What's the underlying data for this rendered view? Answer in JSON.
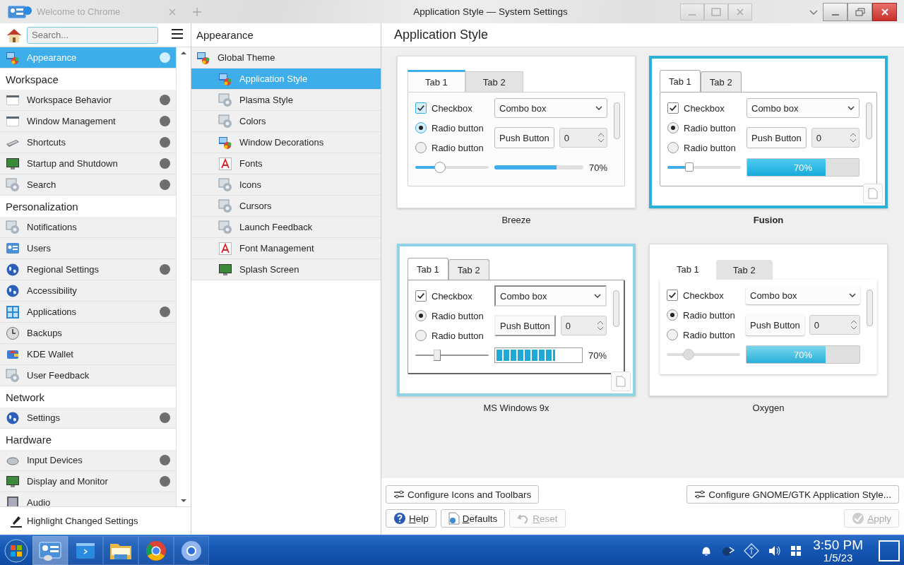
{
  "title_bar": {
    "background_tab": "Welcome to Chrome",
    "title": "Application Style — System Settings"
  },
  "sidebar": {
    "search": {
      "placeholder": "Search..."
    },
    "items": [
      {
        "kind": "item",
        "label": "Appearance",
        "selected": true,
        "changed": true
      },
      {
        "kind": "header",
        "label": "Workspace"
      },
      {
        "kind": "item",
        "label": "Workspace Behavior",
        "selected": false,
        "changed": true
      },
      {
        "kind": "item",
        "label": "Window Management",
        "selected": false,
        "changed": true
      },
      {
        "kind": "item",
        "label": "Shortcuts",
        "selected": false,
        "changed": true
      },
      {
        "kind": "item",
        "label": "Startup and Shutdown",
        "selected": false,
        "changed": true
      },
      {
        "kind": "item",
        "label": "Search",
        "selected": false,
        "changed": true
      },
      {
        "kind": "header",
        "label": "Personalization"
      },
      {
        "kind": "item",
        "label": "Notifications",
        "selected": false,
        "changed": false
      },
      {
        "kind": "item",
        "label": "Users",
        "selected": false,
        "changed": false
      },
      {
        "kind": "item",
        "label": "Regional Settings",
        "selected": false,
        "changed": true
      },
      {
        "kind": "item",
        "label": "Accessibility",
        "selected": false,
        "changed": false
      },
      {
        "kind": "item",
        "label": "Applications",
        "selected": false,
        "changed": true
      },
      {
        "kind": "item",
        "label": "Backups",
        "selected": false,
        "changed": false
      },
      {
        "kind": "item",
        "label": "KDE Wallet",
        "selected": false,
        "changed": false
      },
      {
        "kind": "item",
        "label": "User Feedback",
        "selected": false,
        "changed": false
      },
      {
        "kind": "header",
        "label": "Network"
      },
      {
        "kind": "item",
        "label": "Settings",
        "selected": false,
        "changed": true
      },
      {
        "kind": "header",
        "label": "Hardware"
      },
      {
        "kind": "item",
        "label": "Input Devices",
        "selected": false,
        "changed": true
      },
      {
        "kind": "item",
        "label": "Display and Monitor",
        "selected": false,
        "changed": true
      },
      {
        "kind": "item",
        "label": "Audio",
        "selected": false,
        "changed": false
      }
    ],
    "footer": "Highlight Changed Settings"
  },
  "category": {
    "title": "Appearance",
    "items": [
      {
        "label": "Global Theme",
        "selected": false,
        "children": [
          {
            "label": "Application Style",
            "selected": true
          },
          {
            "label": "Plasma Style",
            "selected": false
          },
          {
            "label": "Colors",
            "selected": false
          },
          {
            "label": "Window Decorations",
            "selected": false
          },
          {
            "label": "Fonts",
            "selected": false
          },
          {
            "label": "Icons",
            "selected": false
          },
          {
            "label": "Cursors",
            "selected": false
          },
          {
            "label": "Launch Feedback",
            "selected": false
          },
          {
            "label": "Font Management",
            "selected": false
          },
          {
            "label": "Splash Screen",
            "selected": false
          }
        ]
      }
    ]
  },
  "page": {
    "title": "Application Style",
    "styles": [
      {
        "kind": "breeze",
        "name": "Breeze",
        "selected": false,
        "hovered": false,
        "preview": {
          "tabs": [
            {
              "label": "Tab 1",
              "selected": true
            },
            {
              "label": "Tab 2",
              "selected": false
            }
          ],
          "checkbox": {
            "label": "Checkbox",
            "checked": true
          },
          "radios": [
            {
              "label": "Radio button",
              "selected": true
            },
            {
              "label": "Radio button",
              "selected": false
            }
          ],
          "combo": "Combo box",
          "push_button": "Push Button",
          "spin": "0",
          "slider": {
            "level": 0.34
          },
          "progress": {
            "level": 0.7,
            "reading": "70%"
          }
        }
      },
      {
        "kind": "fusion",
        "name": "Fusion",
        "selected": true,
        "hovered": false,
        "preview": {
          "tabs": [
            {
              "label": "Tab 1",
              "selected": true
            },
            {
              "label": "Tab 2",
              "selected": false
            }
          ],
          "checkbox": {
            "label": "Checkbox",
            "checked": true
          },
          "radios": [
            {
              "label": "Radio button",
              "selected": true
            },
            {
              "label": "Radio button",
              "selected": false
            }
          ],
          "combo": "Combo box",
          "push_button": "Push Button",
          "spin": "0",
          "slider": {
            "level": 0.3
          },
          "progress": {
            "level": 0.7,
            "reading": "70%"
          }
        }
      },
      {
        "kind": "windows",
        "name": "MS Windows 9x",
        "selected": false,
        "hovered": true,
        "preview": {
          "tabs": [
            {
              "label": "Tab 1",
              "selected": true
            },
            {
              "label": "Tab 2",
              "selected": false
            }
          ],
          "checkbox": {
            "label": "Checkbox",
            "checked": true
          },
          "radios": [
            {
              "label": "Radio button",
              "selected": true
            },
            {
              "label": "Radio button",
              "selected": false
            }
          ],
          "combo": "Combo box",
          "push_button": "Push Button",
          "spin": "0",
          "slider": {
            "level": 0.3
          },
          "progress": {
            "level": 0.7,
            "reading": "70%"
          }
        }
      },
      {
        "kind": "oxygen",
        "name": "Oxygen",
        "selected": false,
        "hovered": false,
        "preview": {
          "tabs": [
            {
              "label": "Tab 1",
              "selected": true
            },
            {
              "label": "Tab 2",
              "selected": false
            }
          ],
          "checkbox": {
            "label": "Checkbox",
            "checked": true
          },
          "radios": [
            {
              "label": "Radio button",
              "selected": true
            },
            {
              "label": "Radio button",
              "selected": false
            }
          ],
          "combo": "Combo box",
          "push_button": "Push Button",
          "spin": "0",
          "slider": {
            "level": 0.3
          },
          "progress": {
            "level": 0.7,
            "reading": "70%"
          }
        }
      }
    ],
    "config_buttons": [
      "Configure Icons and Toolbars",
      "Configure GNOME/GTK Application Style..."
    ]
  },
  "dialog_buttons": [
    {
      "kind": "help",
      "label": "Help",
      "disabled": false
    },
    {
      "kind": "defaults",
      "label": "Defaults",
      "disabled": false
    },
    {
      "kind": "reset",
      "label": "Reset",
      "disabled": true
    },
    {
      "kind": "apply",
      "label": "Apply",
      "disabled": true
    }
  ],
  "taskbar": {
    "apps": [
      {
        "active": true
      },
      {
        "active": false
      },
      {
        "active": false
      },
      {
        "active": false
      },
      {
        "active": false
      }
    ],
    "clock": {
      "time": "3:50 PM",
      "date": "1/5/23"
    }
  }
}
